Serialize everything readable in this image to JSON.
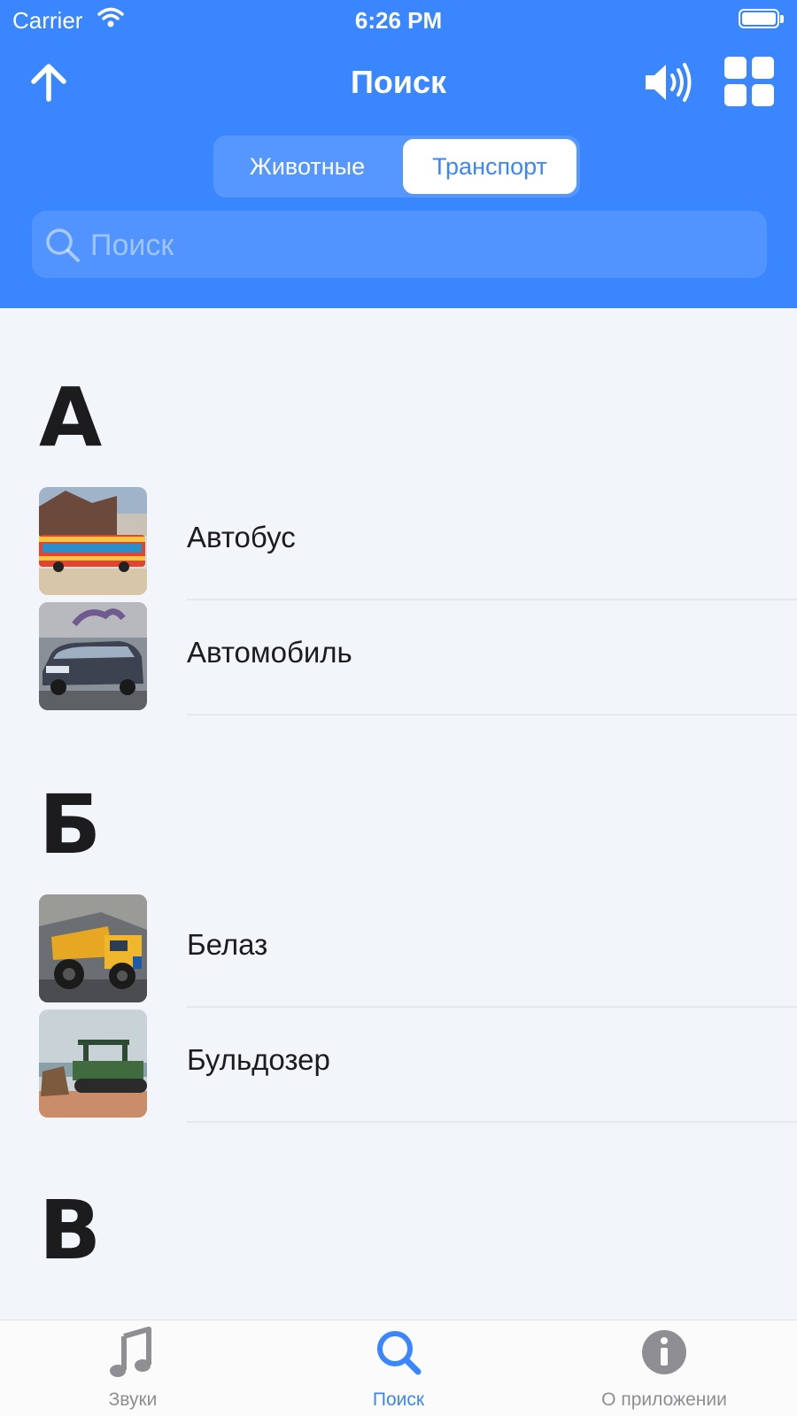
{
  "status_bar": {
    "carrier": "Carrier",
    "time": "6:26 PM"
  },
  "nav": {
    "title": "Поиск"
  },
  "segments": [
    {
      "label": "Животные",
      "selected": false
    },
    {
      "label": "Транспорт",
      "selected": true
    }
  ],
  "search": {
    "placeholder": "Поиск",
    "value": ""
  },
  "sections": [
    {
      "letter": "А",
      "items": [
        {
          "name": "Автобус"
        },
        {
          "name": "Автомобиль"
        }
      ]
    },
    {
      "letter": "Б",
      "items": [
        {
          "name": "Белаз"
        },
        {
          "name": "Бульдозер"
        }
      ]
    },
    {
      "letter": "В",
      "items": []
    }
  ],
  "tabbar": {
    "items": [
      {
        "label": "Звуки",
        "icon": "music-note-icon",
        "active": false
      },
      {
        "label": "Поиск",
        "icon": "search-icon",
        "active": true
      },
      {
        "label": "О приложении",
        "icon": "info-icon",
        "active": false
      }
    ]
  },
  "colors": {
    "accent": "#3a86ff",
    "background": "#f2f5fa",
    "inactive_tab": "#8e8e93"
  }
}
